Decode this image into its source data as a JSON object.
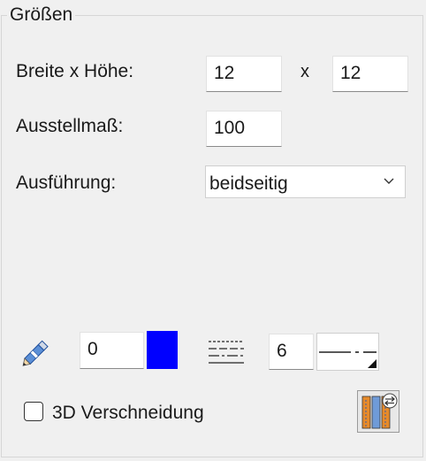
{
  "group": {
    "title": "Größen"
  },
  "size": {
    "label": "Breite x Höhe:",
    "width": "12",
    "separator": "x",
    "height": "12"
  },
  "scale": {
    "label": "Ausstellmaß:",
    "value": "100"
  },
  "execution": {
    "label": "Ausführung:",
    "selected": "beidseitig"
  },
  "pen": {
    "icon": "pencil-icon",
    "width": "0",
    "color": "#0000ff"
  },
  "linetype": {
    "icon": "line-style-icon",
    "value": "6"
  },
  "cut3d": {
    "label": "3D Verschneidung",
    "checked": false
  },
  "settings_button": {
    "icon": "wall-settings-icon"
  }
}
